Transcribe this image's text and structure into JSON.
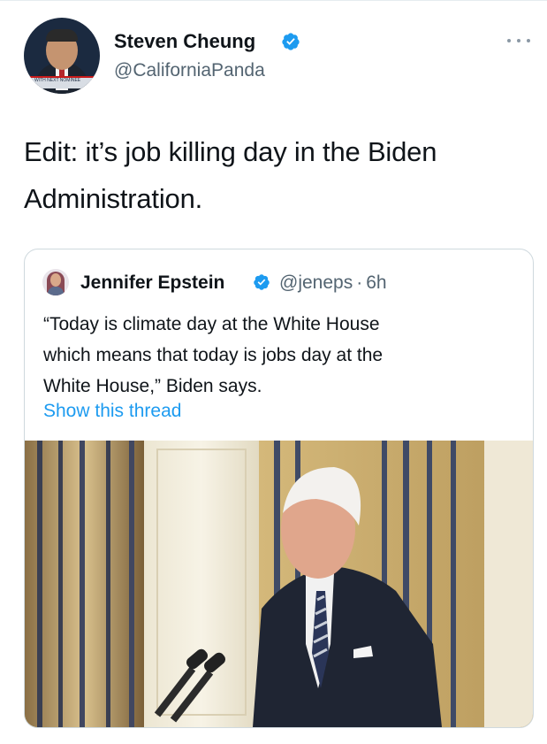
{
  "tweet": {
    "author": {
      "name": "Steven Cheung",
      "handle": "@CaliforniaPanda",
      "verified": true,
      "avatar_banner_text": "WITH NEXT NOMINEE"
    },
    "text_line1": "Edit: it’s job killing day in the Biden",
    "text_line2": "Administration.",
    "more_icon": "more-dots-icon"
  },
  "quoted": {
    "author": {
      "name": "Jennifer Epstein",
      "handle": "@jeneps",
      "separator": "·",
      "time": "6h",
      "verified": true
    },
    "text_line1": "“Today is climate day at the White House",
    "text_line2": "which means that today is jobs day at the",
    "text_line3": "White House,” Biden says.",
    "show_thread": "Show this thread"
  },
  "colors": {
    "link": "#1d9bf0",
    "verified": "#1d9bf0",
    "secondary_text": "#536471",
    "border": "#cfd9de"
  }
}
